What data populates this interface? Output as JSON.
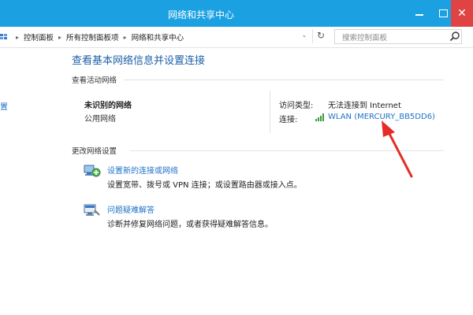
{
  "window": {
    "title": "网络和共享中心",
    "close_glyph": "✕"
  },
  "address_bar": {
    "breadcrumbs": [
      "控制面板",
      "所有控制面板项",
      "网络和共享中心"
    ],
    "separator": "▸",
    "dropdown_glyph": "⌄",
    "refresh_glyph": "↻",
    "search_placeholder": "搜索控制面板"
  },
  "sidebar": {
    "cut_off_text": "置"
  },
  "main": {
    "title": "查看基本网络信息并设置连接",
    "active_networks": {
      "heading": "查看活动网络",
      "network_name": "未识别的网络",
      "network_type": "公用网络",
      "access_type_label": "访问类型:",
      "access_type_value": "无法连接到 Internet",
      "connections_label": "连接:",
      "connection_name": "WLAN (MERCURY_BB5DD6)"
    },
    "change_settings": {
      "heading": "更改网络设置",
      "tasks": [
        {
          "link": "设置新的连接或网络",
          "description": "设置宽带、拨号或 VPN 连接；或设置路由器或接入点。",
          "icon": "network-setup-icon"
        },
        {
          "link": "问题疑难解答",
          "description": "诊断并修复网络问题，或者获得疑难解答信息。",
          "icon": "troubleshoot-icon"
        }
      ]
    }
  },
  "colors": {
    "titlebar": "#1ba1e2",
    "close_button": "#e04343",
    "link": "#1e73c8",
    "annotation_arrow": "#e52d27"
  }
}
